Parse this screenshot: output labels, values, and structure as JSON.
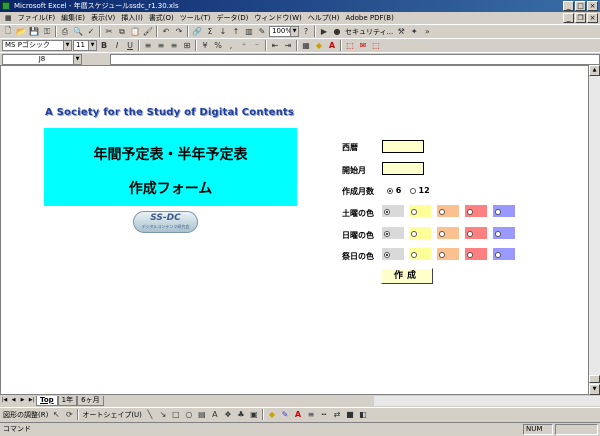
{
  "window": {
    "title": "Microsoft Excel - 年暦スケジュールssdc_r1.30.xls"
  },
  "menu": [
    "ファイル(F)",
    "編集(E)",
    "表示(V)",
    "挿入(I)",
    "書式(O)",
    "ツール(T)",
    "データ(D)",
    "ウィンドウ(W)",
    "ヘルプ(H)",
    "Adobe PDF(B)"
  ],
  "toolbar": {
    "zoom": "100%",
    "security": "セキュリティ..."
  },
  "format": {
    "font": "MS Pゴシック",
    "size": "11"
  },
  "formula": {
    "cell_ref": "J8",
    "content": ""
  },
  "sheet": {
    "banner": "A Society for the Study of Digital Contents",
    "title_line1": "年間予定表・半年予定表",
    "title_line2": "作成フォーム",
    "logo_main": "SS-DC",
    "logo_sub": "デジタルコンテンツ研究会",
    "label_year": "西暦",
    "label_start": "開始月",
    "label_months": "作成月数",
    "opt6": "6",
    "opt12": "12",
    "label_sat": "土曜の色",
    "label_sun": "日曜の色",
    "label_hol": "祭日の色",
    "swatch_colors": [
      "#d9d9d9",
      "#ffff99",
      "#fac090",
      "#ff8080",
      "#9999ff"
    ],
    "button_create": "作成"
  },
  "tabs": [
    "Top",
    "1年",
    "6ヶ月"
  ],
  "drawing": {
    "menu": "図形の調整(R)",
    "autoshape": "オートシェイプ(U)"
  },
  "status": {
    "mode": "コマンド",
    "num": "NUM"
  }
}
